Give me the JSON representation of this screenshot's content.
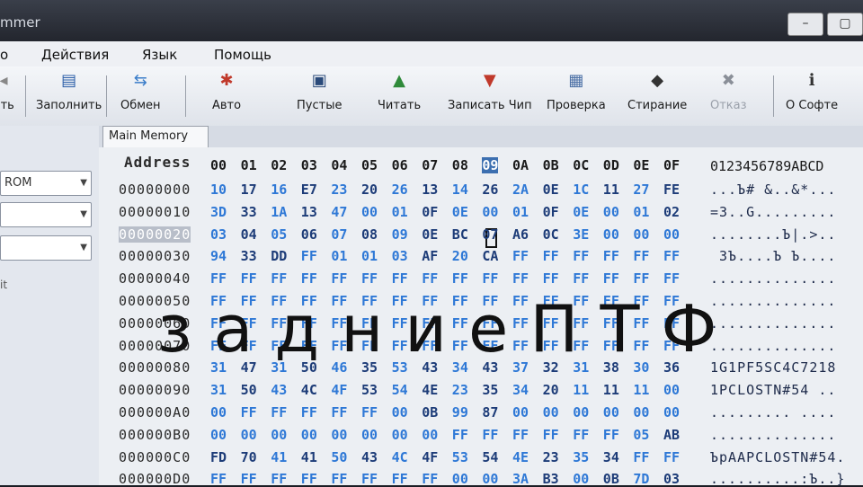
{
  "window": {
    "title": "mmer",
    "controls": [
      "–",
      "▢"
    ]
  },
  "menu": [
    "о",
    "Действия",
    "Язык",
    "Помощь"
  ],
  "toolbar": [
    {
      "label": "ить",
      "icon": "prev-icon",
      "color": "#888888",
      "disabled": false
    },
    {
      "label": "Заполнить",
      "icon": "fill-icon",
      "color": "#2b5ea8",
      "disabled": false
    },
    {
      "label": "Обмен",
      "icon": "swap-icon",
      "color": "#3a7dc9",
      "disabled": false
    },
    {
      "label": "Авто",
      "icon": "auto-icon",
      "color": "#c0392b",
      "disabled": false
    },
    {
      "label": "Пустые",
      "icon": "blank-check-icon",
      "color": "#2a4a7a",
      "disabled": false
    },
    {
      "label": "Читать",
      "icon": "read-chip-icon",
      "color": "#2f8a3a",
      "disabled": false
    },
    {
      "label": "Записать Чип",
      "icon": "write-chip-icon",
      "color": "#c0392b",
      "disabled": false
    },
    {
      "label": "Проверка",
      "icon": "verify-icon",
      "color": "#4a6fa5",
      "disabled": false
    },
    {
      "label": "Стирание",
      "icon": "erase-icon",
      "color": "#333333",
      "disabled": false
    },
    {
      "label": "Отказ",
      "icon": "cancel-icon",
      "color": "#8a8f98",
      "disabled": true
    },
    {
      "label": "О Софте",
      "icon": "info-icon",
      "color": "#333333",
      "disabled": false
    }
  ],
  "left_panel": {
    "combos": [
      "ROM",
      "",
      ""
    ],
    "note": "it"
  },
  "tabs": [
    "Main Memory"
  ],
  "hex": {
    "address_header": "Address",
    "columns": [
      "00",
      "01",
      "02",
      "03",
      "04",
      "05",
      "06",
      "07",
      "08",
      "09",
      "0A",
      "0B",
      "0C",
      "0D",
      "0E",
      "0F"
    ],
    "selected_column": 9,
    "ascii_header": "0123456789ABCD",
    "selected_row": 2,
    "rows": [
      {
        "addr": "00000000",
        "bytes": [
          "10",
          "17",
          "16",
          "E7",
          "23",
          "20",
          "26",
          "13",
          "14",
          "26",
          "2A",
          "0E",
          "1C",
          "11",
          "27",
          "FE"
        ],
        "ascii": "...Ъ# &..&*..."
      },
      {
        "addr": "00000010",
        "bytes": [
          "3D",
          "33",
          "1A",
          "13",
          "47",
          "00",
          "01",
          "0F",
          "0E",
          "00",
          "01",
          "0F",
          "0E",
          "00",
          "01",
          "02"
        ],
        "ascii": "=3..G........."
      },
      {
        "addr": "00000020",
        "bytes": [
          "03",
          "04",
          "05",
          "06",
          "07",
          "08",
          "09",
          "0E",
          "BC",
          "07",
          "A6",
          "0C",
          "3E",
          "00",
          "00",
          "00"
        ],
        "ascii": "........Ъ|.>.."
      },
      {
        "addr": "00000030",
        "bytes": [
          "94",
          "33",
          "DD",
          "FF",
          "01",
          "01",
          "03",
          "AF",
          "20",
          "CA",
          "FF",
          "FF",
          "FF",
          "FF",
          "FF",
          "FF"
        ],
        "ascii": " 3Ъ....Ъ Ъ...."
      },
      {
        "addr": "00000040",
        "bytes": [
          "FF",
          "FF",
          "FF",
          "FF",
          "FF",
          "FF",
          "FF",
          "FF",
          "FF",
          "FF",
          "FF",
          "FF",
          "FF",
          "FF",
          "FF",
          "FF"
        ],
        "ascii": ".............."
      },
      {
        "addr": "00000050",
        "bytes": [
          "FF",
          "FF",
          "FF",
          "FF",
          "FF",
          "FF",
          "FF",
          "FF",
          "FF",
          "FF",
          "FF",
          "FF",
          "FF",
          "FF",
          "FF",
          "FF"
        ],
        "ascii": ".............."
      },
      {
        "addr": "00000060",
        "bytes": [
          "FF",
          "FF",
          "FF",
          "FF",
          "FF",
          "FF",
          "FF",
          "FF",
          "FF",
          "FF",
          "FF",
          "FF",
          "FF",
          "FF",
          "FF",
          "FF"
        ],
        "ascii": ".............."
      },
      {
        "addr": "00000070",
        "bytes": [
          "FF",
          "FF",
          "FF",
          "FF",
          "FF",
          "FF",
          "FF",
          "FF",
          "FF",
          "FF",
          "FF",
          "FF",
          "FF",
          "FF",
          "FF",
          "FF"
        ],
        "ascii": ".............."
      },
      {
        "addr": "00000080",
        "bytes": [
          "31",
          "47",
          "31",
          "50",
          "46",
          "35",
          "53",
          "43",
          "34",
          "43",
          "37",
          "32",
          "31",
          "38",
          "30",
          "36"
        ],
        "ascii": "1G1PF5SC4C7218"
      },
      {
        "addr": "00000090",
        "bytes": [
          "31",
          "50",
          "43",
          "4C",
          "4F",
          "53",
          "54",
          "4E",
          "23",
          "35",
          "34",
          "20",
          "11",
          "11",
          "11",
          "00"
        ],
        "ascii": "1PCLOSTN#54 .."
      },
      {
        "addr": "000000A0",
        "bytes": [
          "00",
          "FF",
          "FF",
          "FF",
          "FF",
          "FF",
          "00",
          "0B",
          "99",
          "87",
          "00",
          "00",
          "00",
          "00",
          "00",
          "00"
        ],
        "ascii": "......... ...."
      },
      {
        "addr": "000000B0",
        "bytes": [
          "00",
          "00",
          "00",
          "00",
          "00",
          "00",
          "00",
          "00",
          "FF",
          "FF",
          "FF",
          "FF",
          "FF",
          "FF",
          "05",
          "AB"
        ],
        "ascii": ".............."
      },
      {
        "addr": "000000C0",
        "bytes": [
          "FD",
          "70",
          "41",
          "41",
          "50",
          "43",
          "4C",
          "4F",
          "53",
          "54",
          "4E",
          "23",
          "35",
          "34",
          "FF",
          "FF"
        ],
        "ascii": "ЪpAAPCLOSTN#54."
      },
      {
        "addr": "000000D0",
        "bytes": [
          "FF",
          "FF",
          "FF",
          "FF",
          "FF",
          "FF",
          "FF",
          "FF",
          "00",
          "00",
          "3A",
          "B3",
          "00",
          "0B",
          "7D",
          "03"
        ],
        "ascii": "..........:Ъ..}"
      }
    ]
  },
  "overlay_caption": "задниеПТФ"
}
